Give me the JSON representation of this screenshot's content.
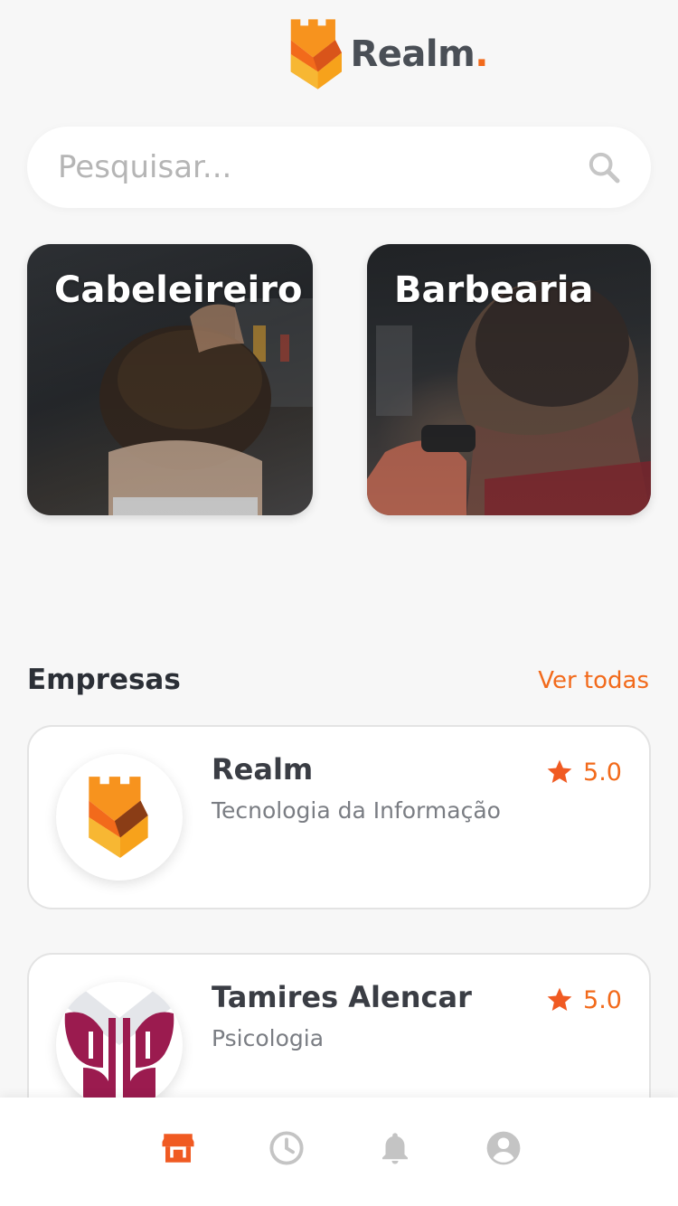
{
  "header": {
    "logo_text": "Realm",
    "logo_dot": "."
  },
  "search": {
    "placeholder": "Pesquisar..."
  },
  "categories": [
    {
      "label": "Cabeleireiro"
    },
    {
      "label": "Barbearia"
    }
  ],
  "companies_section": {
    "title": "Empresas",
    "see_all": "Ver todas"
  },
  "companies": [
    {
      "name": "Realm",
      "category": "Tecnologia da Informação",
      "rating": "5.0",
      "avatar_icon": "realm-logo-icon"
    },
    {
      "name": "Tamires Alencar",
      "category": "Psicologia",
      "rating": "5.0",
      "avatar_icon": "butterfly-logo-icon"
    }
  ],
  "bottom_nav": [
    {
      "icon": "store-icon",
      "active": true
    },
    {
      "icon": "clock-icon",
      "active": false
    },
    {
      "icon": "bell-icon",
      "active": false
    },
    {
      "icon": "account-icon",
      "active": false
    }
  ],
  "colors": {
    "accent": "#f26a1b",
    "logo_orange": "#f7a21b",
    "logo_dark": "#e2571a",
    "inactive_icon": "#c4c4c4",
    "psychology_logo": "#9b1b4f",
    "background": "#f7f7f7"
  }
}
